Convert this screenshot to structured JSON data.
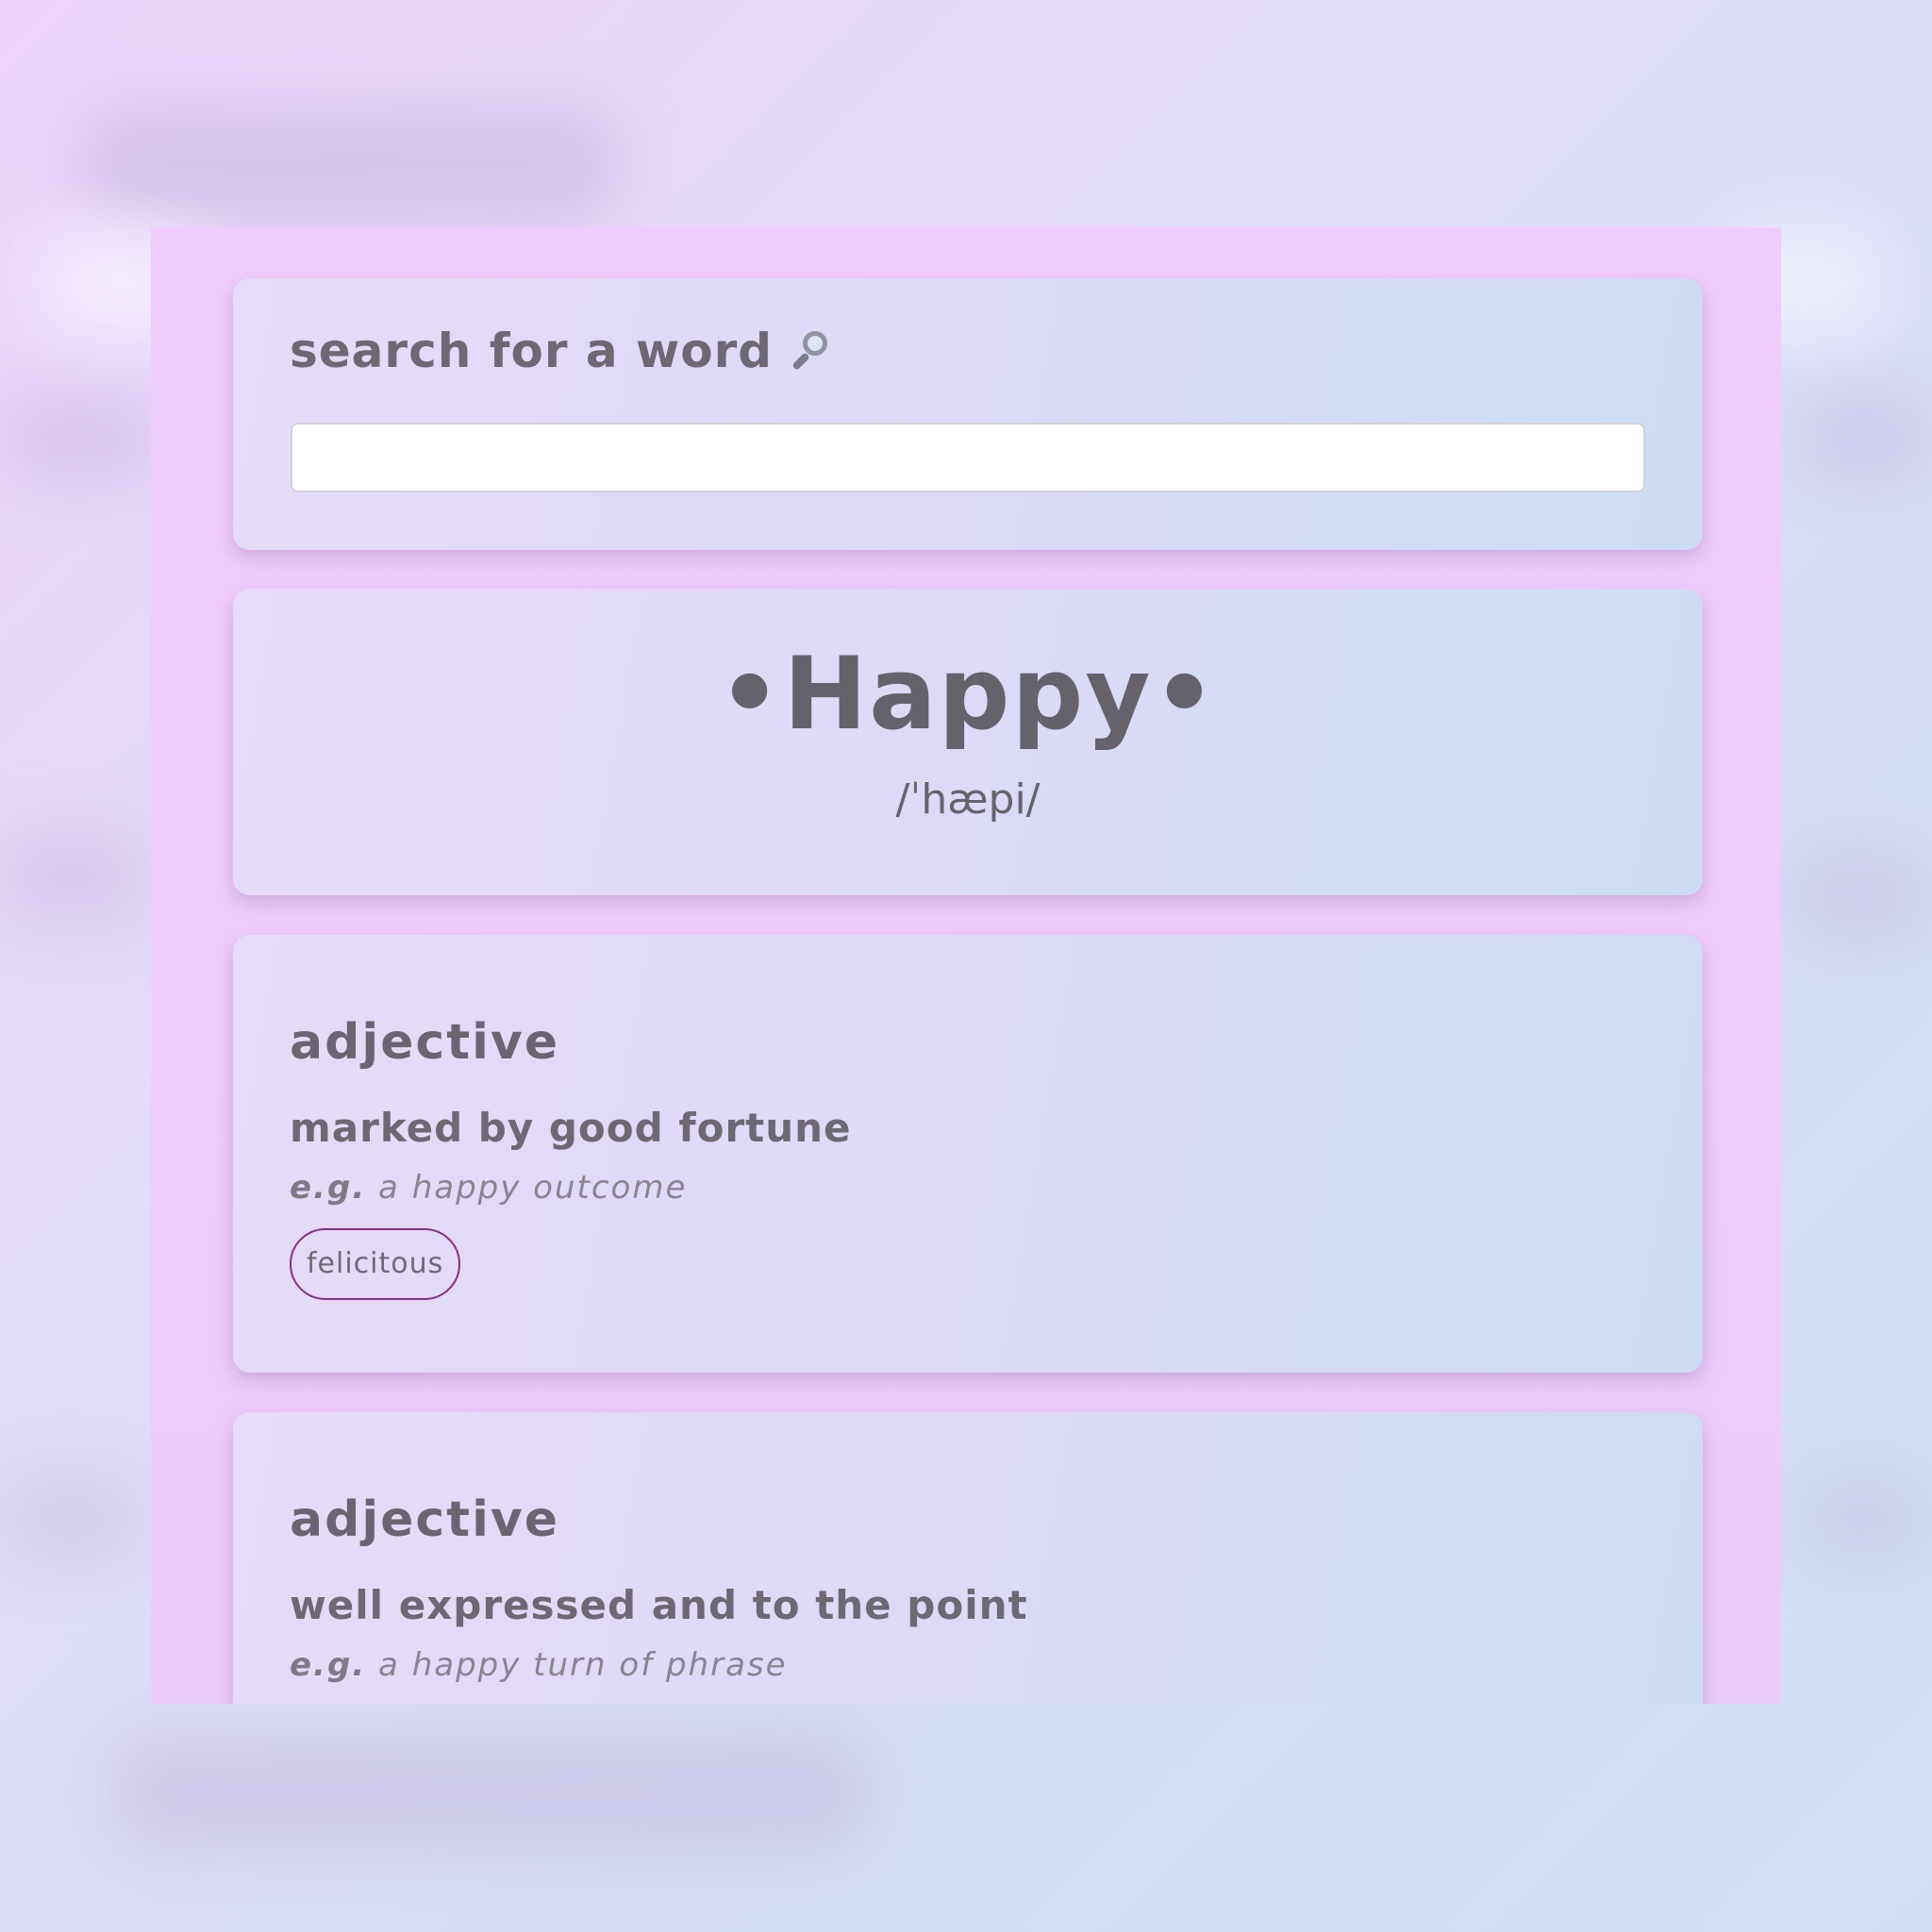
{
  "search": {
    "label": "search for a word",
    "icon": "magnifying-glass-icon",
    "value": "",
    "placeholder": ""
  },
  "word": {
    "headword": "•Happy•",
    "pronunciation": "/ˈhæpi/"
  },
  "definitions": [
    {
      "part_of_speech": "adjective",
      "definition": "marked by good fortune",
      "example_prefix": "e.g.",
      "example": "a happy outcome",
      "synonyms": [
        "felicitous"
      ]
    },
    {
      "part_of_speech": "adjective",
      "definition": "well expressed and to the point",
      "example_prefix": "e.g.",
      "example": "a happy turn of phrase",
      "synonyms": []
    }
  ],
  "colors": {
    "text": "#6b6670",
    "chip_border": "#8b2f84",
    "frame": "#f0ccfc"
  }
}
